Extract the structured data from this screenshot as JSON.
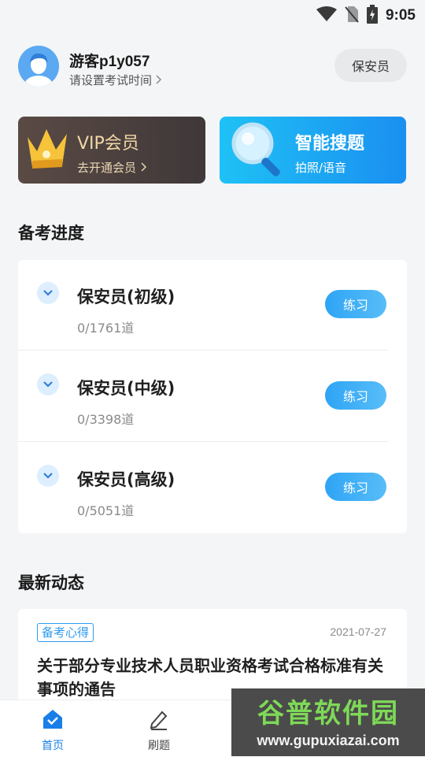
{
  "status_bar": {
    "time": "9:05",
    "icons": [
      "wifi-icon",
      "no-sim-icon",
      "battery-charging-icon"
    ]
  },
  "header": {
    "user_name": "游客p1y057",
    "exam_time_prompt": "请设置考试时间",
    "job_button": "保安员"
  },
  "promo": {
    "vip": {
      "title": "VIP会员",
      "subtitle": "去开通会员"
    },
    "search": {
      "title": "智能搜题",
      "subtitle": "拍照/语音"
    }
  },
  "progress": {
    "section_title": "备考进度",
    "items": [
      {
        "name": "保安员(初级)",
        "count": "0/1761道",
        "action": "练习"
      },
      {
        "name": "保安员(中级)",
        "count": "0/3398道",
        "action": "练习"
      },
      {
        "name": "保安员(高级)",
        "count": "0/5051道",
        "action": "练习"
      }
    ]
  },
  "news": {
    "section_title": "最新动态",
    "items": [
      {
        "tag": "备考心得",
        "date": "2021-07-27",
        "title": "关于部分专业技术人员职业资格考试合格标准有关事项的通告"
      }
    ]
  },
  "bottom_nav": {
    "items": [
      {
        "label": "首页",
        "icon": "home-icon",
        "active": true
      },
      {
        "label": "刷题",
        "icon": "edit-icon",
        "active": false
      }
    ]
  },
  "watermark": {
    "title": "谷普软件园",
    "url": "www.gupuxiazai.com"
  },
  "colors": {
    "accent": "#2e9bf0",
    "active_nav": "#1a7ee8",
    "inactive_nav": "#444444",
    "vip_gold": "#f1d8a8"
  }
}
